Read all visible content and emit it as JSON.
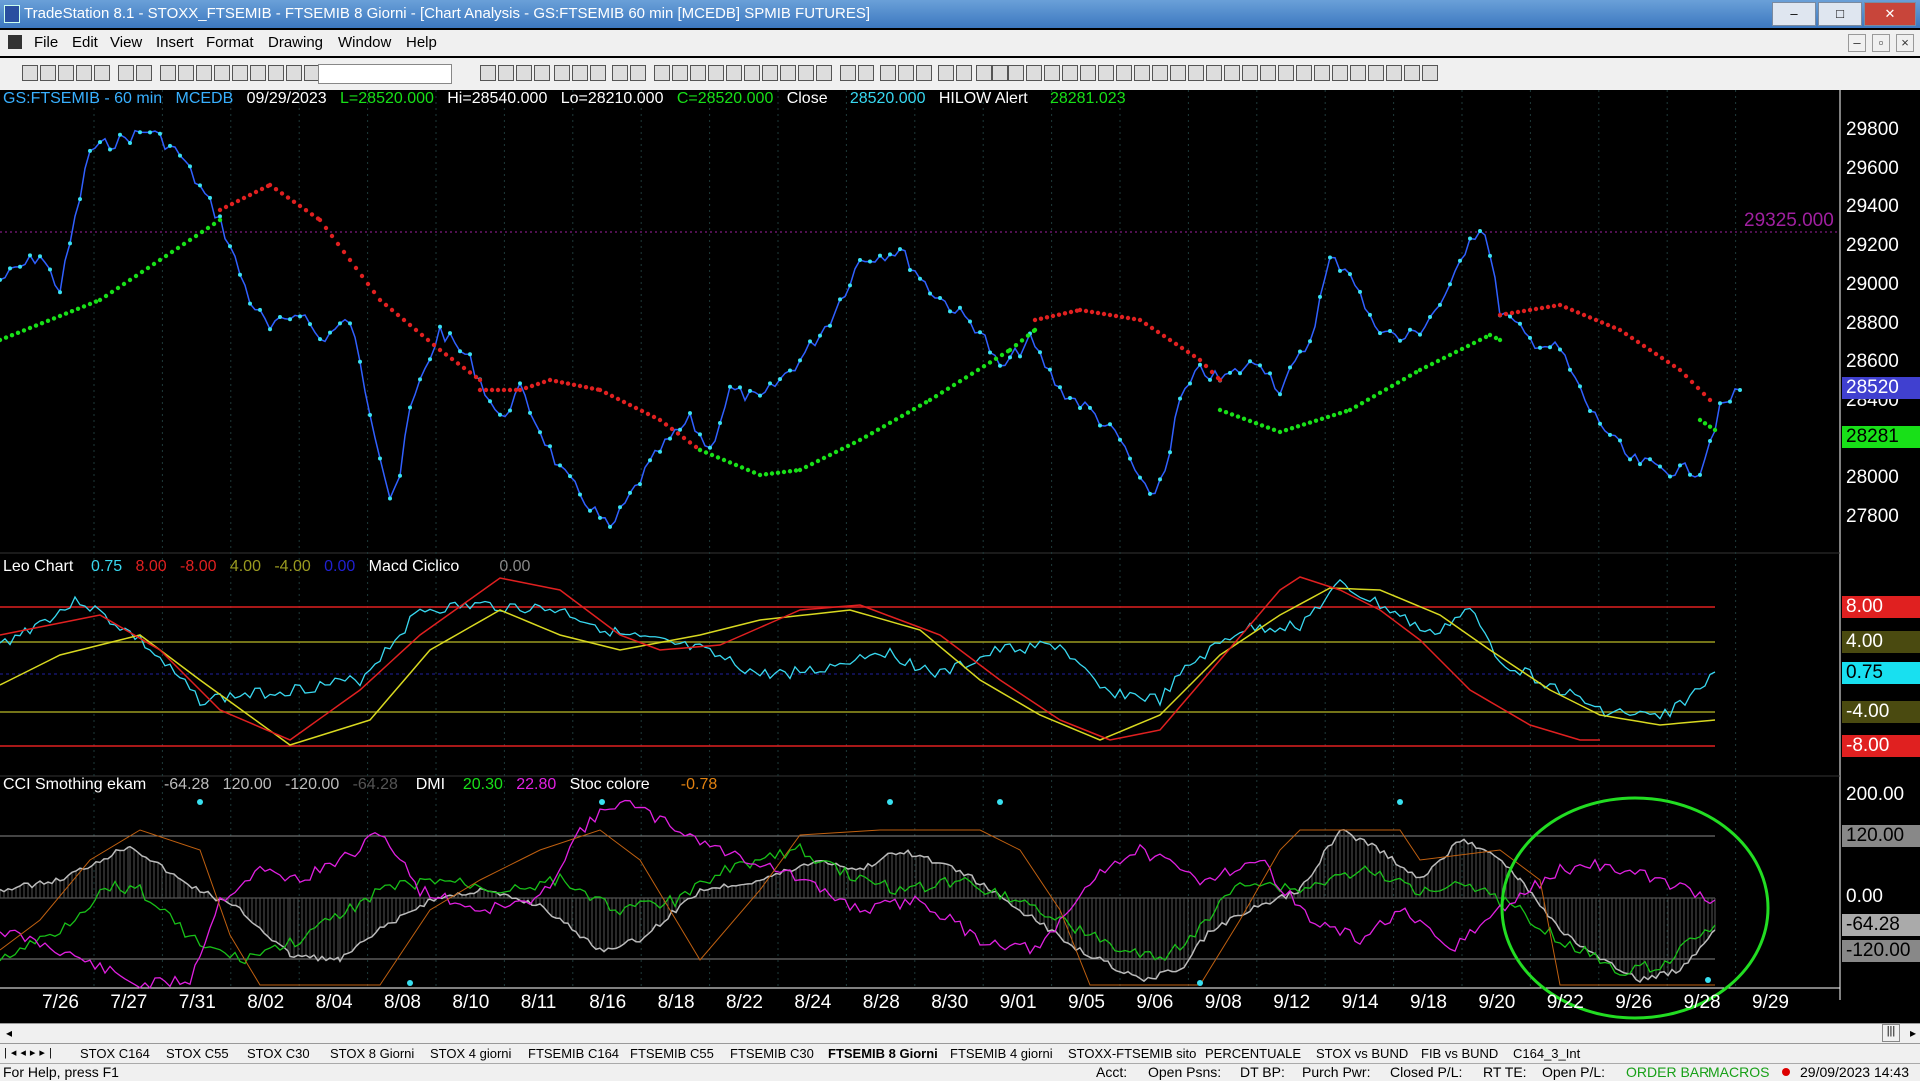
{
  "window": {
    "title": "TradeStation 8.1 - STOXX_FTSEMIB - FTSEMIB  8 Giorni - [Chart Analysis - GS:FTSEMIB  60 min  [MCEDB] SPMIB FUTURES]",
    "minimize": "–",
    "maximize": "□",
    "close": "✕"
  },
  "menu": [
    "File",
    "Edit",
    "View",
    "Insert",
    "Format",
    "Drawing",
    "Window",
    "Help"
  ],
  "chart": {
    "symbol": "GS:FTSEMIB - 60 min",
    "source": "MCEDB",
    "date": "09/29/2023",
    "last": "L=28520.000",
    "high": "Hi=28540.000",
    "low": "Lo=28210.000",
    "close": "C=28520.000",
    "close_label": "Close",
    "close_value": "28520.000",
    "alert_label": "HILOW Alert",
    "alert_value": "28281.023",
    "hline_label": "29325.000",
    "price_tag": "28520",
    "alert_tag": "28281",
    "price_axis": [
      "29800",
      "29600",
      "29400",
      "29200",
      "29000",
      "28800",
      "28600",
      "28400",
      "28200",
      "28000",
      "27800"
    ]
  },
  "macd_panel": {
    "name": "Leo Chart",
    "v1": "0.75",
    "v2": "8.00",
    "v3": "-8.00",
    "v4": "4.00",
    "v5": "-4.00",
    "v6": "0.00",
    "name2": "Macd Ciclico",
    "v7": "0.00",
    "tags": [
      "8.00",
      "4.00",
      "0.75",
      "-4.00",
      "-8.00"
    ]
  },
  "cci_panel": {
    "name": "CCI Smothing ekam",
    "v1": "-64.28",
    "v2": "120.00",
    "v3": "-120.00",
    "v4": "-64.28",
    "dmi": "DMI",
    "dmi1": "20.30",
    "dmi2": "22.80",
    "stoc": "Stoc colore",
    "stoc_v": "-0.78",
    "axis": [
      "200.00",
      "0.00"
    ],
    "tags": [
      "120.00",
      "-64.28",
      "-120.00"
    ]
  },
  "dates": [
    "7/26",
    "7/27",
    "7/31",
    "8/02",
    "8/04",
    "8/08",
    "8/10",
    "8/11",
    "8/16",
    "8/18",
    "8/22",
    "8/24",
    "8/28",
    "8/30",
    "9/01",
    "9/05",
    "9/06",
    "9/08",
    "9/12",
    "9/14",
    "9/18",
    "9/20",
    "9/22",
    "9/26",
    "9/28",
    "9/29"
  ],
  "tabs": [
    "STOX C164",
    "STOX C55",
    "STOX  C30",
    "STOX  8 Giorni",
    "STOX 4 giorni",
    "FTSEMIB C164",
    "FTSEMIB C55",
    "FTSEMIB C30",
    "FTSEMIB  8 Giorni",
    "FTSEMIB  4 giorni",
    "STOXX-FTSEMIB sito",
    "PERCENTUALE",
    "STOX vs BUND",
    "FIB vs BUND",
    "C164_3_Int"
  ],
  "active_tab": "FTSEMIB  8 Giorni",
  "status": {
    "help": "For Help, press F1",
    "acct": "Acct:",
    "open_psns": "Open Psns:",
    "dt_bp": "DT BP:",
    "purch": "Purch Pwr:",
    "closed_pl": "Closed P/L:",
    "rt_te": "RT TE:",
    "open_pl": "Open P/L:",
    "order_bar": "ORDER BAR",
    "macros": "MACROS",
    "datetime": "29/09/2023 14:43"
  }
}
